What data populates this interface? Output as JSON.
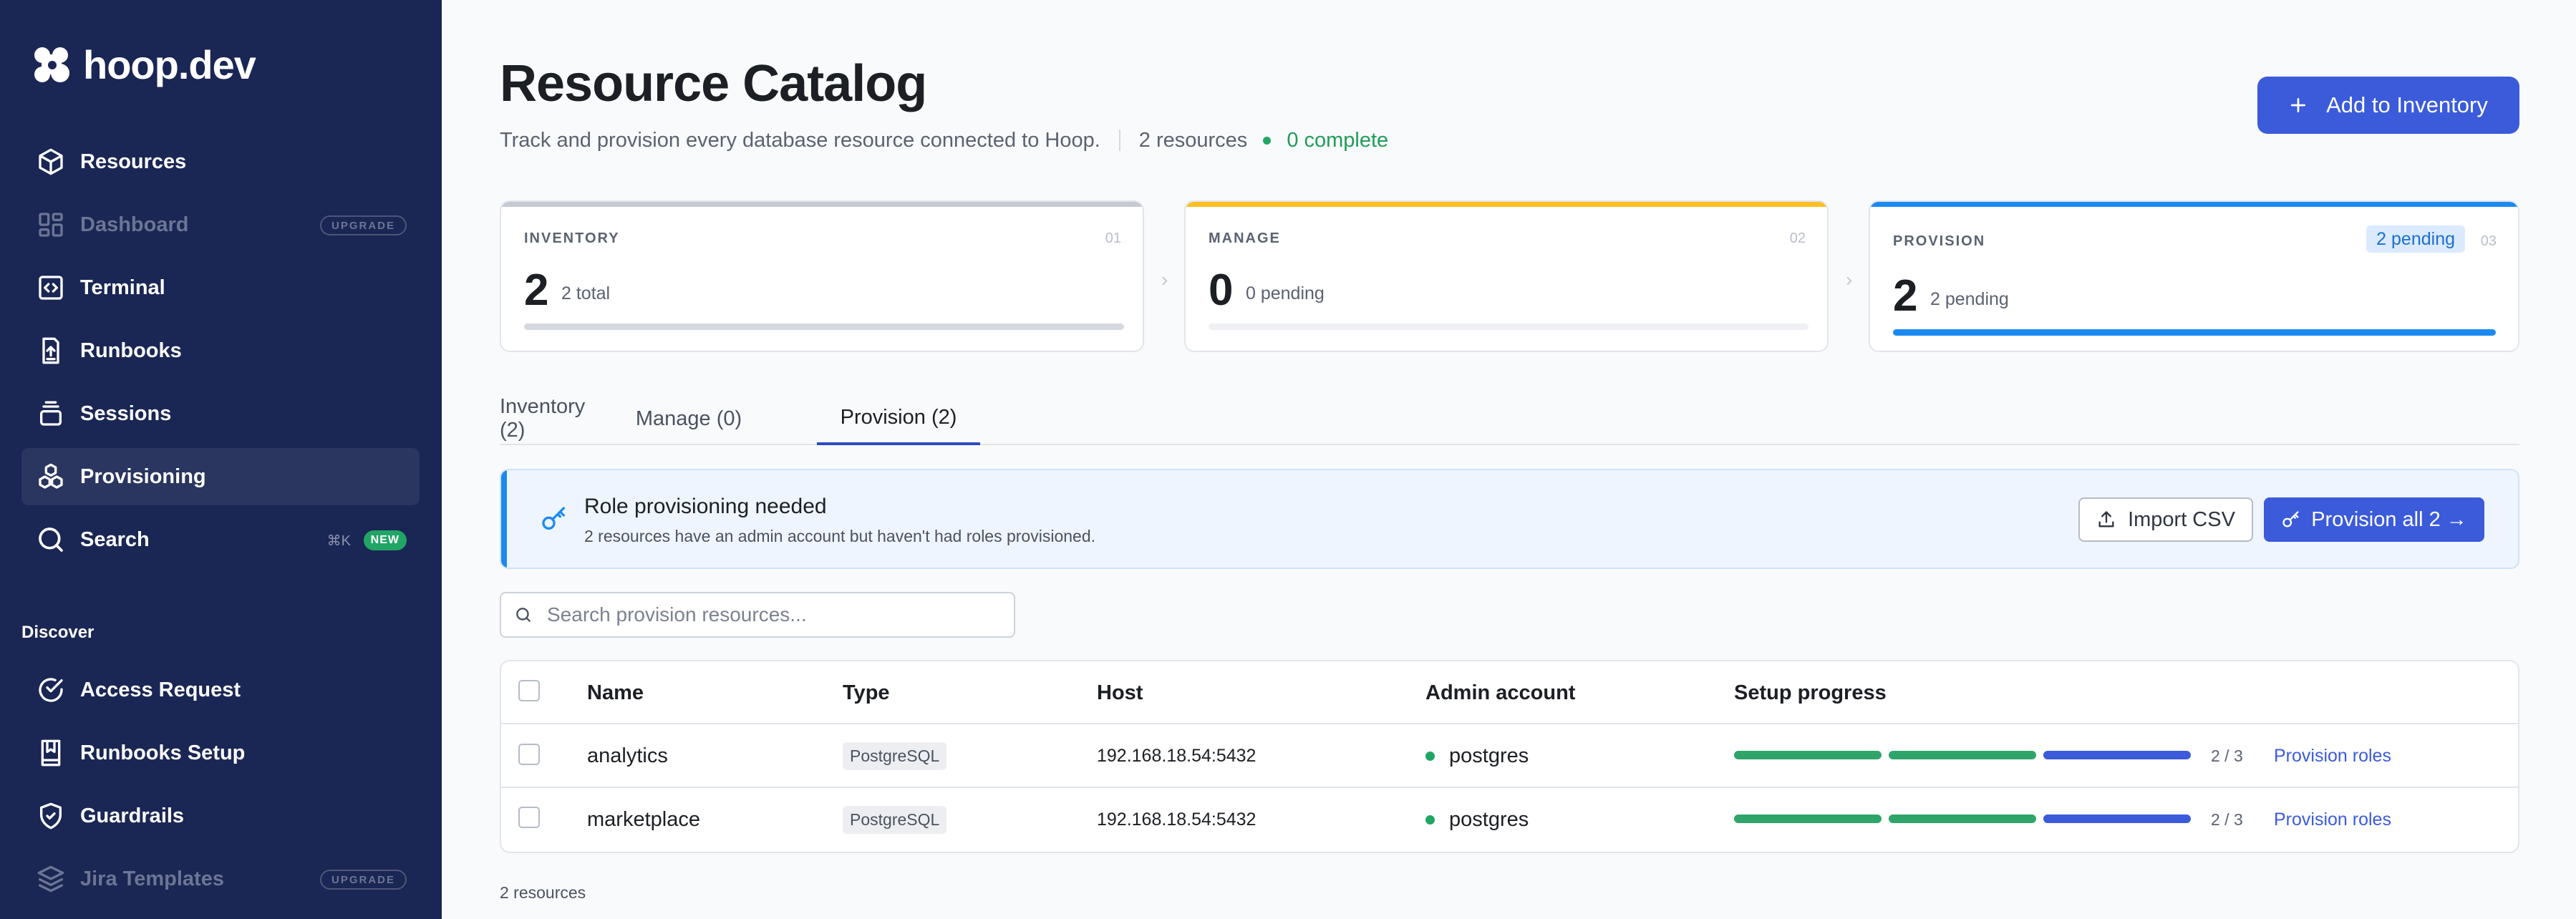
{
  "app": {
    "logo_text": "hoop.dev"
  },
  "sidebar": {
    "items": [
      {
        "label": "Resources",
        "icon": "cube-icon"
      },
      {
        "label": "Dashboard",
        "icon": "dashboard-icon",
        "badge": "UPGRADE",
        "disabled": true
      },
      {
        "label": "Terminal",
        "icon": "terminal-icon"
      },
      {
        "label": "Runbooks",
        "icon": "runbook-icon"
      },
      {
        "label": "Sessions",
        "icon": "stack-icon"
      },
      {
        "label": "Provisioning",
        "icon": "cubes-icon",
        "active": true
      },
      {
        "label": "Search",
        "icon": "search-icon",
        "shortcut": "⌘K",
        "badge": "NEW"
      }
    ],
    "discover_title": "Discover",
    "discover_items": [
      {
        "label": "Access Request",
        "icon": "check-circle-icon"
      },
      {
        "label": "Runbooks Setup",
        "icon": "book-bookmark-icon"
      },
      {
        "label": "Guardrails",
        "icon": "shield-check-icon"
      },
      {
        "label": "Jira Templates",
        "icon": "layers-icon",
        "badge": "UPGRADE",
        "disabled": true
      }
    ]
  },
  "header": {
    "title": "Resource Catalog",
    "subtitle": "Track and provision every database resource connected to Hoop.",
    "resource_count": "2 resources",
    "complete_count": "0 complete",
    "add_button": "Add to Inventory"
  },
  "cards": [
    {
      "label": "INVENTORY",
      "num": "01",
      "value": "2",
      "sub": "2 total",
      "color": "#c4c9d2",
      "fill": 1.0,
      "fill_color": "#d5d8de"
    },
    {
      "label": "MANAGE",
      "num": "02",
      "value": "0",
      "sub": "0 pending",
      "color": "#fbbf24",
      "fill": 0.0,
      "fill_color": "#eef0f3"
    },
    {
      "label": "PROVISION",
      "num": "03",
      "value": "2",
      "sub": "2 pending",
      "pill": "2 pending",
      "color": "#1b8af0",
      "fill": 1.0,
      "fill_color": "#1b8af0"
    }
  ],
  "tabs": [
    {
      "label": "Inventory (2)"
    },
    {
      "label": "Manage (0)"
    },
    {
      "label": "Provision (2)",
      "active": true
    }
  ],
  "banner": {
    "title": "Role provisioning needed",
    "description": "2 resources have an admin account but haven't had roles provisioned.",
    "import_button": "Import CSV",
    "provision_button": "Provision all 2 →"
  },
  "search": {
    "placeholder": "Search provision resources..."
  },
  "table": {
    "columns": [
      "Name",
      "Type",
      "Host",
      "Admin account",
      "Setup progress"
    ],
    "rows": [
      {
        "name": "analytics",
        "type": "PostgreSQL",
        "host": "192.168.18.54:5432",
        "admin": "postgres",
        "progress": "2 / 3",
        "progress_value": 0.667,
        "action": "Provision roles"
      },
      {
        "name": "marketplace",
        "type": "PostgreSQL",
        "host": "192.168.18.54:5432",
        "admin": "postgres",
        "progress": "2 / 3",
        "progress_value": 0.667,
        "action": "Provision roles"
      }
    ]
  },
  "footer": {
    "count": "2 resources"
  },
  "colors": {
    "sidebar_bg": "#1a2654",
    "accent": "#3b5bdb",
    "success": "#21a565",
    "info": "#1b8af0"
  }
}
